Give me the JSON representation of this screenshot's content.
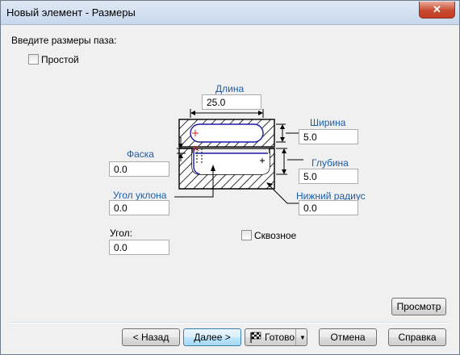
{
  "window": {
    "title": "Новый элемент - Размеры",
    "close_label": "✕"
  },
  "prompt": "Введите размеры паза:",
  "simple_checkbox": {
    "label": "Простой",
    "checked": false
  },
  "through_checkbox": {
    "label": "Сквозное",
    "checked": false
  },
  "fields": {
    "length": {
      "label": "Длина",
      "value": "25.0"
    },
    "width": {
      "label": "Ширина",
      "value": "5.0"
    },
    "chamfer": {
      "label": "Фаска",
      "value": "0.0"
    },
    "depth": {
      "label": "Глубина",
      "value": "5.0"
    },
    "draft": {
      "label": "Угол уклона",
      "value": "0.0"
    },
    "bottom_radius": {
      "label": "Нижний радиус",
      "value": "0.0"
    },
    "angle": {
      "label": "Угол:",
      "value": "0.0"
    }
  },
  "buttons": {
    "preview": "Просмотр",
    "back": "< Назад",
    "next": "Далее >",
    "finish": "Готово",
    "cancel": "Отмена",
    "help": "Справка"
  },
  "colors": {
    "label_blue": "#1c5ea8",
    "default_button": "#3c7fb1",
    "close_red": "#c94a31"
  }
}
